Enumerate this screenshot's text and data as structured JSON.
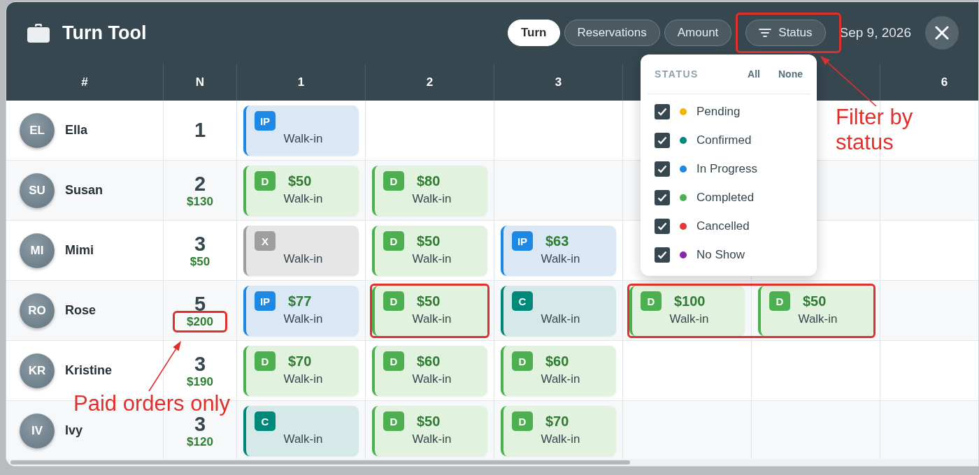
{
  "window": {
    "title": "Turn Tool",
    "date": "Sep 9, 2026"
  },
  "view_tabs": [
    {
      "label": "Turn",
      "selected": true
    },
    {
      "label": "Reservations",
      "selected": false
    },
    {
      "label": "Amount",
      "selected": false
    }
  ],
  "status_button": {
    "label": "Status",
    "highlighted": true
  },
  "table": {
    "columns": [
      {
        "label": "#"
      },
      {
        "label": "N"
      },
      {
        "label": "1"
      },
      {
        "label": "2"
      },
      {
        "label": "3"
      },
      {},
      {},
      {
        "label": "6"
      }
    ],
    "rows": [
      {
        "initials": "EL",
        "name": "Ella",
        "count": "1",
        "cards": [
          {
            "kind": "in_progress",
            "badge": "IP",
            "place": "Walk-in",
            "highlighted": false
          }
        ]
      },
      {
        "initials": "SU",
        "name": "Susan",
        "count": "2",
        "total": "$130",
        "total_highlighted": false,
        "cards": [
          {
            "kind": "done",
            "badge": "D",
            "amount": "$50",
            "place": "Walk-in",
            "highlighted": false
          },
          {
            "kind": "done",
            "badge": "D",
            "amount": "$80",
            "place": "Walk-in",
            "highlighted": false
          }
        ]
      },
      {
        "initials": "MI",
        "name": "Mimi",
        "count": "3",
        "total": "$50",
        "total_highlighted": false,
        "cards": [
          {
            "kind": "cancelled",
            "badge": "X",
            "place": "Walk-in",
            "highlighted": false
          },
          {
            "kind": "done",
            "badge": "D",
            "amount": "$50",
            "place": "Walk-in",
            "highlighted": false
          },
          {
            "kind": "in_progress",
            "badge": "IP",
            "amount": "$63",
            "place": "Walk-in",
            "highlighted": false
          }
        ]
      },
      {
        "initials": "RO",
        "name": "Rose",
        "count": "5",
        "total": "$200",
        "total_highlighted": true,
        "cards": [
          {
            "kind": "in_progress",
            "badge": "IP",
            "amount": "$77",
            "place": "Walk-in",
            "highlighted": false
          },
          {
            "kind": "done",
            "badge": "D",
            "amount": "$50",
            "place": "Walk-in",
            "highlighted": true
          },
          {
            "kind": "confirmed",
            "badge": "C",
            "place": "Walk-in",
            "highlighted": false
          },
          {
            "kind": "done",
            "badge": "D",
            "amount": "$100",
            "place": "Walk-in",
            "highlighted": true
          },
          {
            "kind": "done",
            "badge": "D",
            "amount": "$50",
            "place": "Walk-in",
            "highlighted": true
          }
        ]
      },
      {
        "initials": "KR",
        "name": "Kristine",
        "count": "3",
        "total": "$190",
        "total_highlighted": false,
        "cards": [
          {
            "kind": "done",
            "badge": "D",
            "amount": "$70",
            "place": "Walk-in",
            "highlighted": false
          },
          {
            "kind": "done",
            "badge": "D",
            "amount": "$60",
            "place": "Walk-in",
            "highlighted": false
          },
          {
            "kind": "done",
            "badge": "D",
            "amount": "$60",
            "place": "Walk-in",
            "highlighted": false
          }
        ]
      },
      {
        "initials": "IV",
        "name": "Ivy",
        "count": "3",
        "total": "$120",
        "total_highlighted": false,
        "cards": [
          {
            "kind": "confirmed",
            "badge": "C",
            "place": "Walk-in",
            "highlighted": false
          },
          {
            "kind": "done",
            "badge": "D",
            "amount": "$50",
            "place": "Walk-in",
            "highlighted": false
          },
          {
            "kind": "done",
            "badge": "D",
            "amount": "$70",
            "place": "Walk-in",
            "highlighted": false
          }
        ]
      }
    ]
  },
  "status_filter": {
    "heading": "STATUS",
    "all": "All",
    "none": "None",
    "options": [
      {
        "label": "Pending",
        "checked": true,
        "color": "#f4b400"
      },
      {
        "label": "Confirmed",
        "checked": true,
        "color": "#00897b"
      },
      {
        "label": "In Progress",
        "checked": true,
        "color": "#1e88e5"
      },
      {
        "label": "Completed",
        "checked": true,
        "color": "#4caf50"
      },
      {
        "label": "Cancelled",
        "checked": true,
        "color": "#e53935"
      },
      {
        "label": "No Show",
        "checked": true,
        "color": "#8e24aa"
      }
    ]
  },
  "annotations": [
    {
      "text": "Filter by\nstatus"
    },
    {
      "text": "Paid orders only"
    }
  ]
}
